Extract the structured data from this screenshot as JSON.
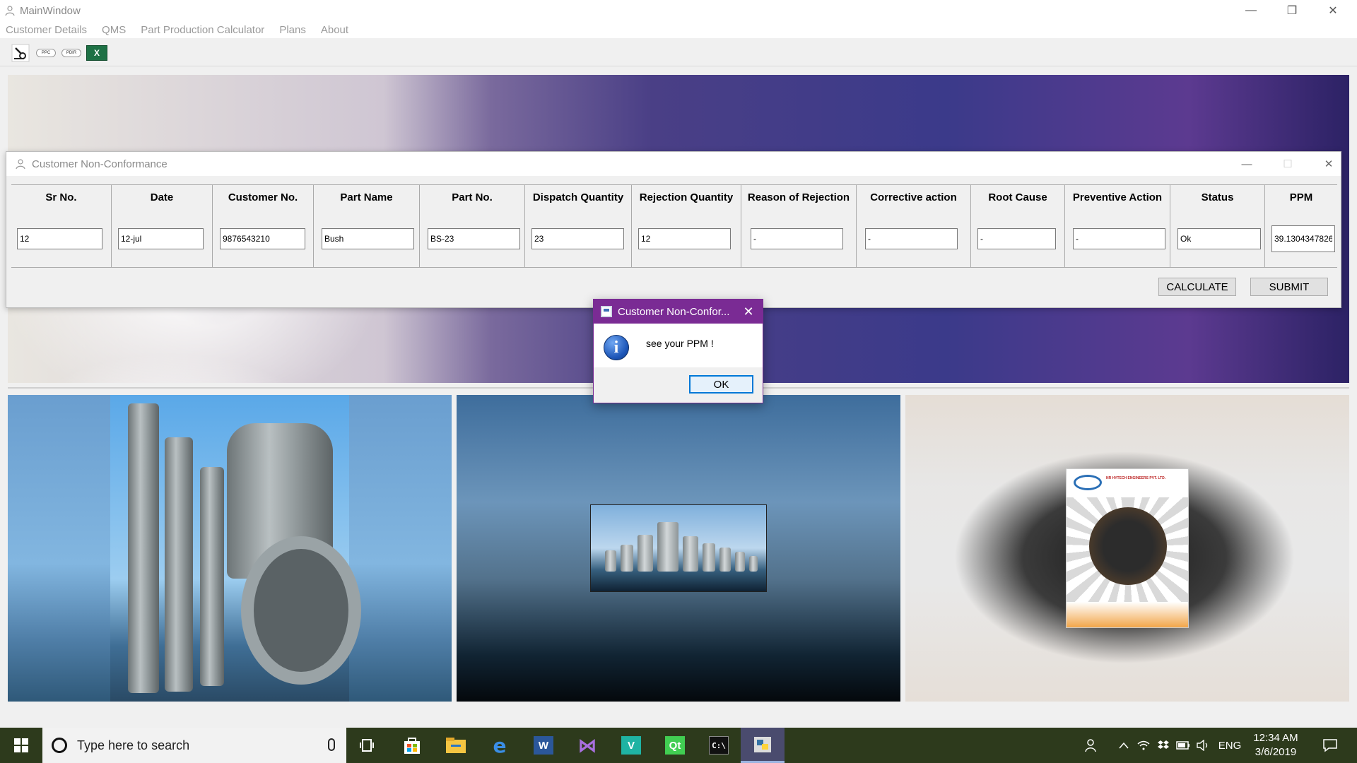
{
  "window": {
    "title": "MainWindow",
    "controls": {
      "minimize": "—",
      "restore": "❐",
      "close": "✕"
    }
  },
  "menu": [
    "Customer Details",
    "QMS",
    "Part Production Calculator",
    "Plans",
    "About"
  ],
  "toolbar": {
    "buttons": [
      {
        "icon": "wrench-icon"
      },
      {
        "label": "PPC"
      },
      {
        "label": "PDIR"
      },
      {
        "label": "X",
        "icon": "excel-icon"
      }
    ]
  },
  "nc_window": {
    "title": "Customer Non-Conformance",
    "controls": {
      "minimize": "—",
      "maximize": "☐",
      "close": "✕"
    },
    "columns": [
      {
        "header": "Sr No.",
        "value": "12"
      },
      {
        "header": "Date",
        "value": "12-jul"
      },
      {
        "header": "Customer No.",
        "value": "9876543210"
      },
      {
        "header": "Part Name",
        "value": "Bush"
      },
      {
        "header": "Part No.",
        "value": "BS-23"
      },
      {
        "header": "Dispatch Quantity",
        "value": "23"
      },
      {
        "header": "Rejection Quantity",
        "value": "12"
      },
      {
        "header": "Reason of Rejection",
        "value": "-"
      },
      {
        "header": "Corrective action",
        "value": "-"
      },
      {
        "header": "Root Cause",
        "value": "-"
      },
      {
        "header": "Preventive Action",
        "value": "-"
      },
      {
        "header": "Status",
        "value": "Ok"
      },
      {
        "header": "PPM",
        "value": "39.1304347826"
      }
    ],
    "calculate_label": "CALCULATE",
    "submit_label": "SUBMIT"
  },
  "messagebox": {
    "title": "Customer Non-Confor...",
    "close": "✕",
    "icon": "info-icon",
    "text": "see your PPM !",
    "ok_label": "OK"
  },
  "brochure": {
    "company": "NR HYTECH ENGINEERS PVT. LTD."
  },
  "taskbar": {
    "search_placeholder": "Type here to search",
    "apps": [
      "task-view-icon",
      "store-icon",
      "file-explorer-icon",
      "edge-icon",
      "word-icon",
      "visual-studio-icon",
      "app-icon",
      "qt-creator-icon",
      "terminal-icon",
      "python-icon"
    ],
    "language": "ENG",
    "time": "12:34 AM",
    "date": "3/6/2019"
  },
  "colors": {
    "dialog_accent": "#7a2b94",
    "taskbar_bg": "#2d3a1c",
    "ok_border": "#0078d7"
  }
}
